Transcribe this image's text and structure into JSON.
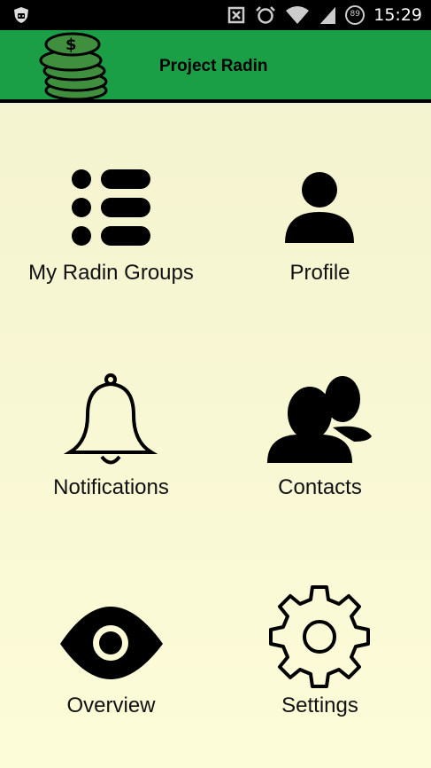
{
  "status_bar": {
    "time": "15:29",
    "battery_level": "89",
    "icons": [
      "app-shield-icon",
      "nfc-icon",
      "alarm-icon",
      "wifi-icon",
      "signal-icon",
      "battery-icon"
    ]
  },
  "app_bar": {
    "title": "Project Radin",
    "logo_icon": "coin-stack-icon",
    "background_color": "#1a9e46"
  },
  "menu": {
    "items": [
      {
        "label": "My Radin Groups",
        "icon": "list-icon"
      },
      {
        "label": "Profile",
        "icon": "person-icon"
      },
      {
        "label": "Notifications",
        "icon": "bell-icon"
      },
      {
        "label": "Contacts",
        "icon": "contacts-icon"
      },
      {
        "label": "Overview",
        "icon": "eye-icon"
      },
      {
        "label": "Settings",
        "icon": "gear-icon"
      }
    ]
  }
}
